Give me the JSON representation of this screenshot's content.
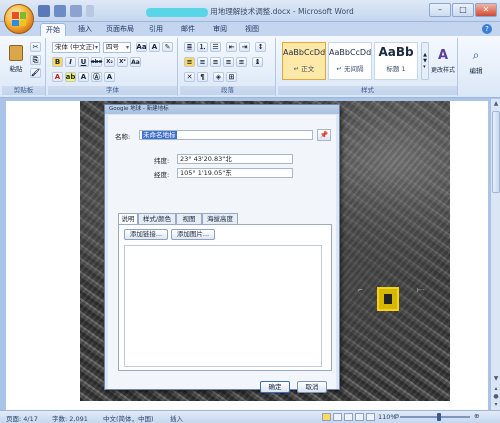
{
  "window": {
    "title": "用地理解技术调整.docx - Microsoft Word",
    "controls": {
      "minimize": "–",
      "maximize": "□",
      "close": "✕"
    }
  },
  "qat": {
    "icons": [
      "save-icon",
      "undo-icon",
      "redo-icon",
      "customize-icon"
    ]
  },
  "tabs": [
    "开始",
    "插入",
    "页面布局",
    "引用",
    "邮件",
    "审阅",
    "视图"
  ],
  "active_tab": "开始",
  "ribbon": {
    "clipboard": {
      "label": "剪贴板",
      "paste": "粘贴"
    },
    "font": {
      "label": "字体",
      "font_name": "宋体 (中文正)",
      "font_size": "四号",
      "tool_glyphs": [
        "B",
        "I",
        "U",
        "abe",
        "X₂",
        "X²",
        "Aa",
        "A",
        "A",
        "Ⓐ",
        "A",
        "A"
      ]
    },
    "paragraph": {
      "label": "段落"
    },
    "styles": {
      "label": "样式",
      "items": [
        {
          "sample": "AaBbCcDd",
          "name": "↵ 正文"
        },
        {
          "sample": "AaBbCcDd",
          "name": "↵ 无间隔"
        },
        {
          "sample": "AaBb",
          "name": "标题 1"
        }
      ],
      "change_styles": "更改样式"
    },
    "editing": {
      "label": "编辑"
    }
  },
  "dialog": {
    "title": "Google 地球 - 新建地标",
    "name_label": "名称:",
    "name_value": "未命名地标",
    "latitude_label": "纬度:",
    "latitude_value": "23° 43'20.83\"北",
    "longitude_label": "经度:",
    "longitude_value": "105° 1'19.05\"东",
    "tabs": [
      "说明",
      "样式/颜色",
      "视图",
      "海拔高度"
    ],
    "active_tab": "说明",
    "add_link": "添加链接...",
    "add_image": "添加图片...",
    "ok": "确定",
    "cancel": "取消"
  },
  "statusbar": {
    "page": "页面: 4/17",
    "words": "字数: 2,091",
    "language": "中文(简体，中国)",
    "insert": "插入",
    "zoom": "110%",
    "zoom_level": 0.55
  }
}
